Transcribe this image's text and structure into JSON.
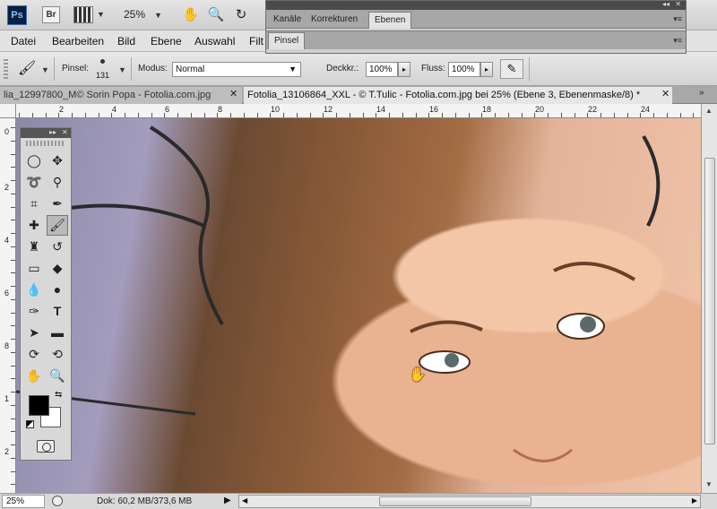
{
  "appbar": {
    "logo": "Ps",
    "bridge": "Br",
    "zoom": "25%"
  },
  "menu": [
    "Datei",
    "Bearbeiten",
    "Bild",
    "Ebene",
    "Auswahl",
    "Filt"
  ],
  "options": {
    "brush_label": "Pinsel:",
    "brush_size": "131",
    "mode_label": "Modus:",
    "mode_value": "Normal",
    "opacity_label": "Deckkr.:",
    "opacity_value": "100%",
    "flow_label": "Fluss:",
    "flow_value": "100%"
  },
  "tabs": [
    {
      "label": "lia_12997800_M© Sorin Popa - Fotolia.com.jpg",
      "active": false
    },
    {
      "label": "Fotolia_13106864_XXL - © T.Tulic - Fotolia.com.jpg bei 25% (Ebene 3, Ebenenmaske/8) *",
      "active": true
    }
  ],
  "ruler_top": [
    "2",
    "4",
    "6",
    "8",
    "10",
    "12",
    "14",
    "16",
    "18",
    "20",
    "22",
    "24"
  ],
  "ruler_left": [
    "0",
    "2",
    "4",
    "6",
    "8",
    "1",
    "2"
  ],
  "panels": {
    "tabs": [
      "Kanäle",
      "Korrekturen",
      "Ebenen"
    ],
    "active_tab": "Ebenen",
    "second": "Pinsel"
  },
  "status": {
    "zoom": "25%",
    "doc": "Dok: 60,2 MB/373,6 MB"
  },
  "colors": {
    "foreground": "#000000",
    "background": "#ffffff"
  }
}
